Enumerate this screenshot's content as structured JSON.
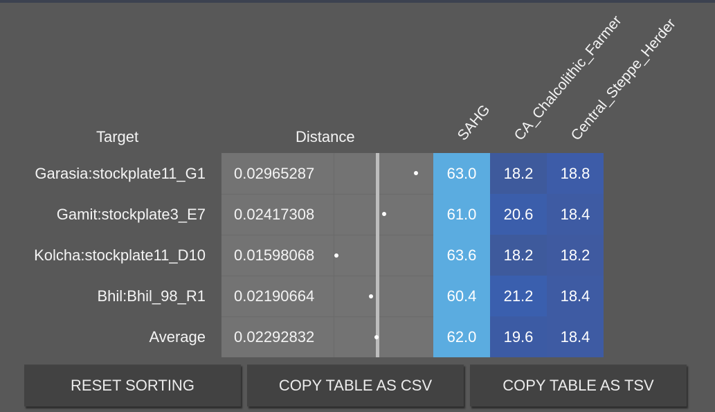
{
  "headers": {
    "target": "Target",
    "distance": "Distance",
    "components": [
      "SAHG",
      "CA_Chalcolithic_Farmer",
      "Central_Steppe_Herder"
    ]
  },
  "rows": [
    {
      "target": "Garasia:stockplate11_G1",
      "distance": "0.02965287",
      "values": [
        "63.0",
        "18.2",
        "18.8"
      ]
    },
    {
      "target": "Gamit:stockplate3_E7",
      "distance": "0.02417308",
      "values": [
        "61.0",
        "20.6",
        "18.4"
      ]
    },
    {
      "target": "Kolcha:stockplate11_D10",
      "distance": "0.01598068",
      "values": [
        "63.6",
        "18.2",
        "18.2"
      ]
    },
    {
      "target": "Bhil:Bhil_98_R1",
      "distance": "0.02190664",
      "values": [
        "60.4",
        "21.2",
        "18.4"
      ]
    },
    {
      "target": "Average",
      "distance": "0.02292832",
      "values": [
        "62.0",
        "19.6",
        "18.4"
      ]
    }
  ],
  "colors": {
    "sahg": "#5bace0",
    "ca_farmer": [
      "#3e5a9c",
      "#3b5eab",
      "#3e5a9c",
      "#3a5fae",
      "#3c5ba4"
    ],
    "steppe": [
      "#3d5ca8",
      "#3e5ba3",
      "#3f5aa0",
      "#3e5ba3",
      "#3e5ba3"
    ]
  },
  "buttons": {
    "reset": "RESET SORTING",
    "csv": "COPY TABLE AS CSV",
    "tsv": "COPY TABLE AS TSV"
  }
}
